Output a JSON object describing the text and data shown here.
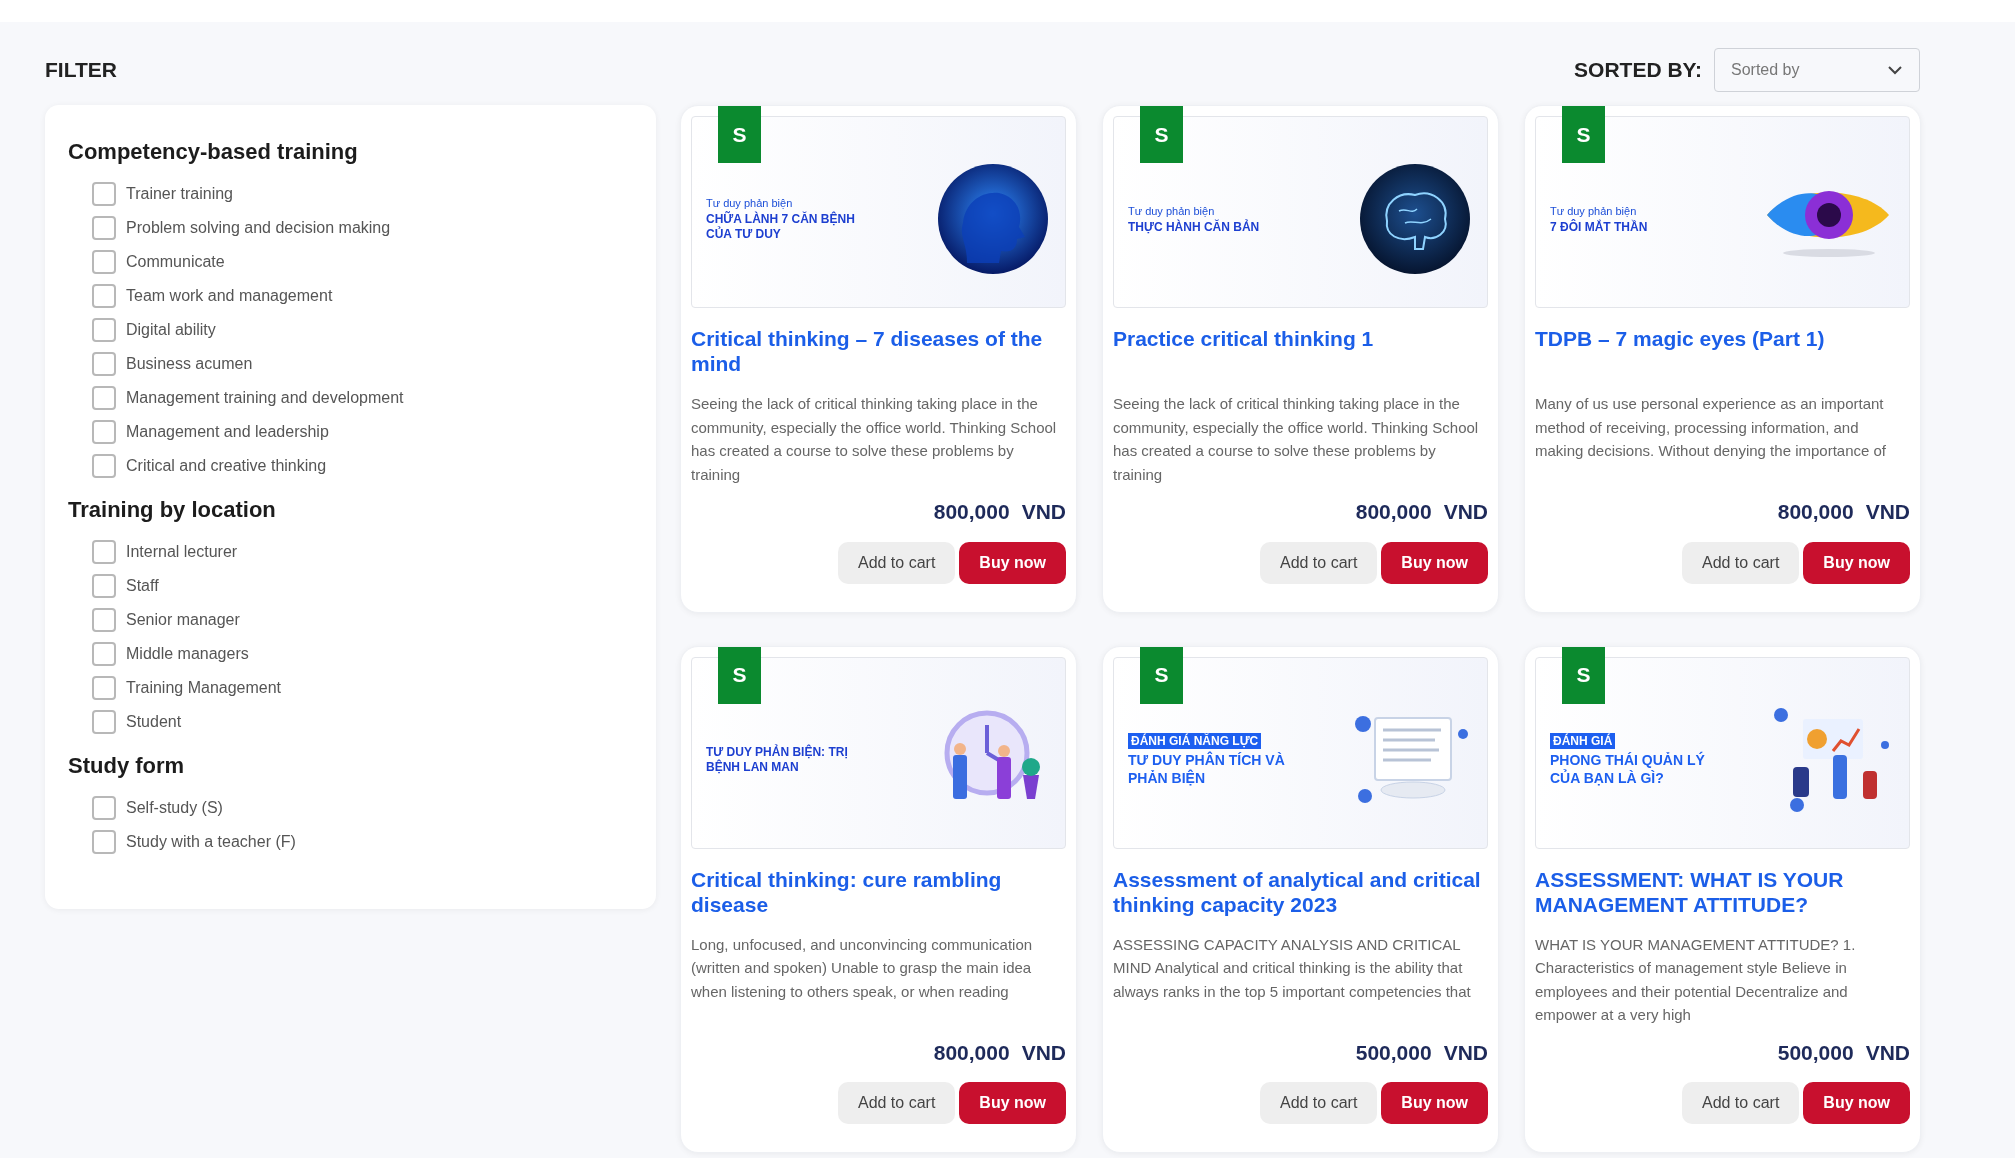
{
  "filter": {
    "title": "FILTER",
    "groups": [
      {
        "heading": "Competency-based training",
        "items": [
          {
            "label": "Trainer training",
            "checked": false
          },
          {
            "label": "Problem solving and decision making",
            "checked": false
          },
          {
            "label": "Communicate",
            "checked": false
          },
          {
            "label": "Team work and management",
            "checked": false
          },
          {
            "label": "Digital ability",
            "checked": false
          },
          {
            "label": "Business acumen",
            "checked": false
          },
          {
            "label": "Management training and development",
            "checked": false
          },
          {
            "label": "Management and leadership",
            "checked": false
          },
          {
            "label": "Critical and creative thinking",
            "checked": false
          }
        ]
      },
      {
        "heading": "Training by location",
        "items": [
          {
            "label": "Internal lecturer",
            "checked": false
          },
          {
            "label": "Staff",
            "checked": false
          },
          {
            "label": "Senior manager",
            "checked": false
          },
          {
            "label": "Middle managers",
            "checked": false
          },
          {
            "label": "Training Management",
            "checked": false
          },
          {
            "label": "Student",
            "checked": false
          }
        ]
      },
      {
        "heading": "Study form",
        "items": [
          {
            "label": "Self-study (S)",
            "checked": false
          },
          {
            "label": "Study with a teacher (F)",
            "checked": false
          }
        ]
      }
    ]
  },
  "sort": {
    "label": "SORTED BY:",
    "placeholder": "Sorted by"
  },
  "cards": [
    {
      "badge": "S",
      "image": {
        "kind": "head",
        "tag": {
          "kind": "plain",
          "text": "Tư duy phản biện"
        },
        "headline": "CHỮA LÀNH 7 CĂN BỆNH CỦA TƯ DUY"
      },
      "title": "Critical thinking – 7 diseases of the mind",
      "description": "Seeing the lack of critical thinking taking place in the community, especially the office world. Thinking School has created a course to solve these problems by training",
      "price": "800,000",
      "currency": "VND",
      "buttons": [
        "Add to cart",
        "Buy now"
      ]
    },
    {
      "badge": "S",
      "image": {
        "kind": "brain",
        "tag": {
          "kind": "plain",
          "text": "Tư duy phản biện"
        },
        "headline": "THỰC HÀNH CĂN BẢN"
      },
      "title": "Practice critical thinking 1",
      "description": "Seeing the lack of critical thinking taking place in the community, especially the office world. Thinking School has created a course to solve these problems by training",
      "price": "800,000",
      "currency": "VND",
      "buttons": [
        "Add to cart",
        "Buy now"
      ]
    },
    {
      "badge": "S",
      "image": {
        "kind": "eye",
        "tag": {
          "kind": "plain",
          "text": "Tư duy phản biện"
        },
        "headline": "7 ĐÔI MẮT THẦN"
      },
      "title": "TDPB – 7 magic eyes (Part 1)",
      "description": "Many of us use personal experience as an important method of receiving, processing information, and making decisions. Without denying the importance of",
      "price": "800,000",
      "currency": "VND",
      "buttons": [
        "Add to cart",
        "Buy now"
      ]
    },
    {
      "badge": "S",
      "image": {
        "kind": "clock",
        "headline": "TƯ DUY PHẢN BIỆN: TRỊ BỆNH LAN MAN"
      },
      "title": "Critical thinking: cure rambling disease",
      "description": "Long, unfocused, and unconvincing communication (written and spoken) Unable to grasp the main idea when listening to others speak, or when reading",
      "price": "800,000",
      "currency": "VND",
      "buttons": [
        "Add to cart",
        "Buy now"
      ]
    },
    {
      "badge": "S",
      "image": {
        "kind": "report",
        "tag": {
          "kind": "boxed",
          "text": "ĐÁNH GIÁ NĂNG LỰC"
        },
        "headline": "TƯ DUY PHÂN TÍCH VÀ PHẢN BIỆN"
      },
      "title": "Assessment of analytical and critical thinking capacity 2023",
      "description": "ASSESSING CAPACITY ANALYSIS AND CRITICAL MIND Analytical and critical thinking is the ability that always ranks in the top 5 important competencies that",
      "price": "500,000",
      "currency": "VND",
      "buttons": [
        "Add to cart",
        "Buy now"
      ]
    },
    {
      "badge": "S",
      "image": {
        "kind": "team",
        "tag": {
          "kind": "boxed",
          "text": "ĐÁNH GIÁ"
        },
        "headline": "PHONG THÁI QUẢN LÝ CỦA BẠN LÀ GÌ?"
      },
      "title": "ASSESSMENT: WHAT IS YOUR MANAGEMENT ATTITUDE?",
      "description": "WHAT IS YOUR MANAGEMENT ATTITUDE? 1. Characteristics of management style Believe in employees and their potential Decentralize and empower at a very high",
      "price": "500,000",
      "currency": "VND",
      "buttons": [
        "Add to cart",
        "Buy now"
      ]
    }
  ]
}
